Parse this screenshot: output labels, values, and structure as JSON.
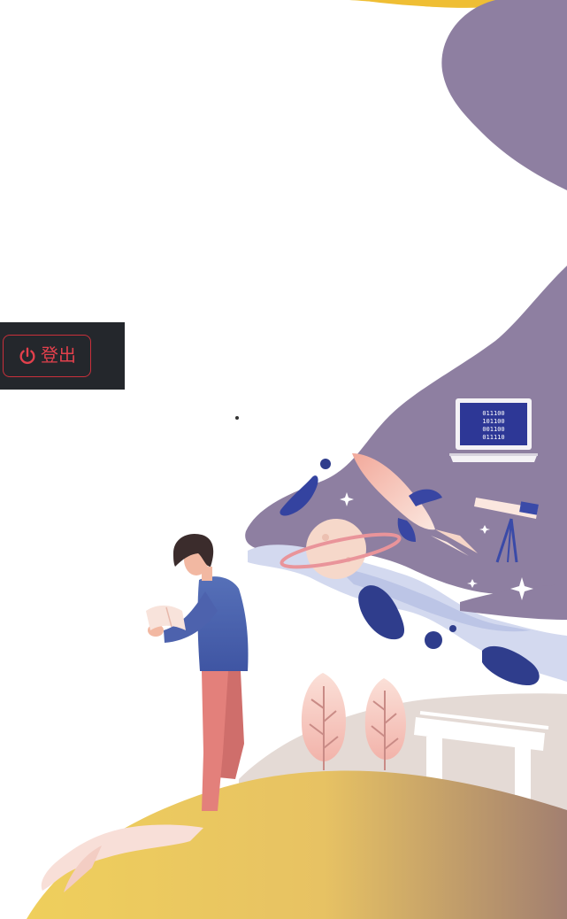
{
  "logout": {
    "label": "登出",
    "icon": "power-icon",
    "color": "#e2404c",
    "bar_color": "#24272c"
  },
  "illustration": {
    "laptop_screen_lines": [
      "011100",
      "101100",
      "001100",
      "011110"
    ],
    "colors": {
      "purple_wave": "#8e7fa1",
      "blue_wave": "#cfd6ec",
      "navy_blob": "#2f3d8c",
      "hill_yellow": "#e9c75b",
      "hill_brown": "#a7826d",
      "building": "#e6ddd6",
      "rocket_pink": "#f3b7a8",
      "planet": "#f5d5c8",
      "man_shirt": "#4d62ad",
      "man_pants": "#e3807b",
      "hair": "#3b2c2c",
      "skin": "#f2b8a2"
    }
  }
}
